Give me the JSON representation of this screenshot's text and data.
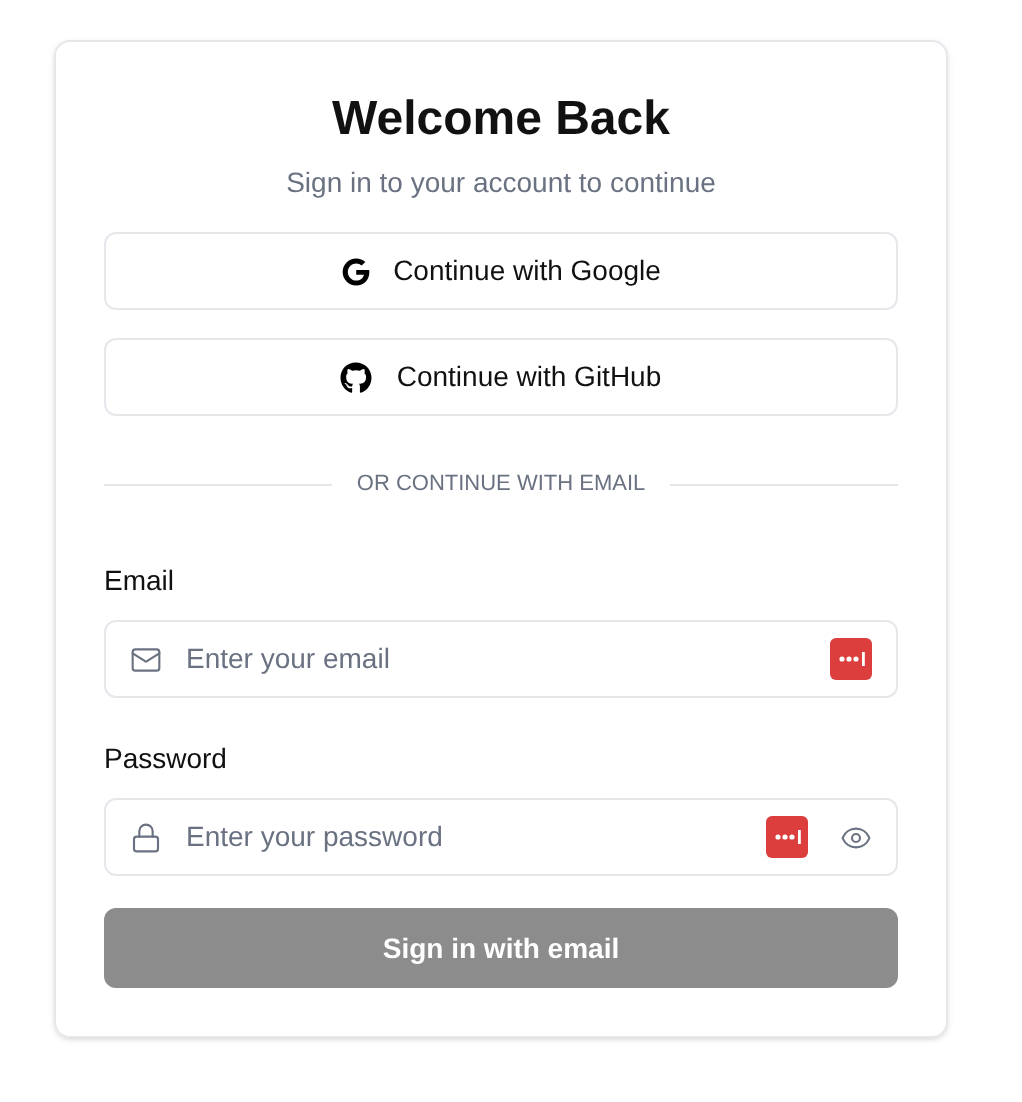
{
  "title": "Welcome Back",
  "subtitle": "Sign in to your account to continue",
  "social_buttons": [
    {
      "kind": "google",
      "label": "Continue with Google"
    },
    {
      "kind": "github",
      "label": "Continue with GitHub"
    }
  ],
  "divider": "OR CONTINUE WITH EMAIL",
  "fields": [
    {
      "kind": "email",
      "label": "Email",
      "placeholder": "Enter your email",
      "password_toggle": false
    },
    {
      "kind": "password",
      "label": "Password",
      "placeholder": "Enter your password",
      "password_toggle": true
    }
  ],
  "submit": {
    "label": "Sign in with email",
    "disabled": true
  }
}
